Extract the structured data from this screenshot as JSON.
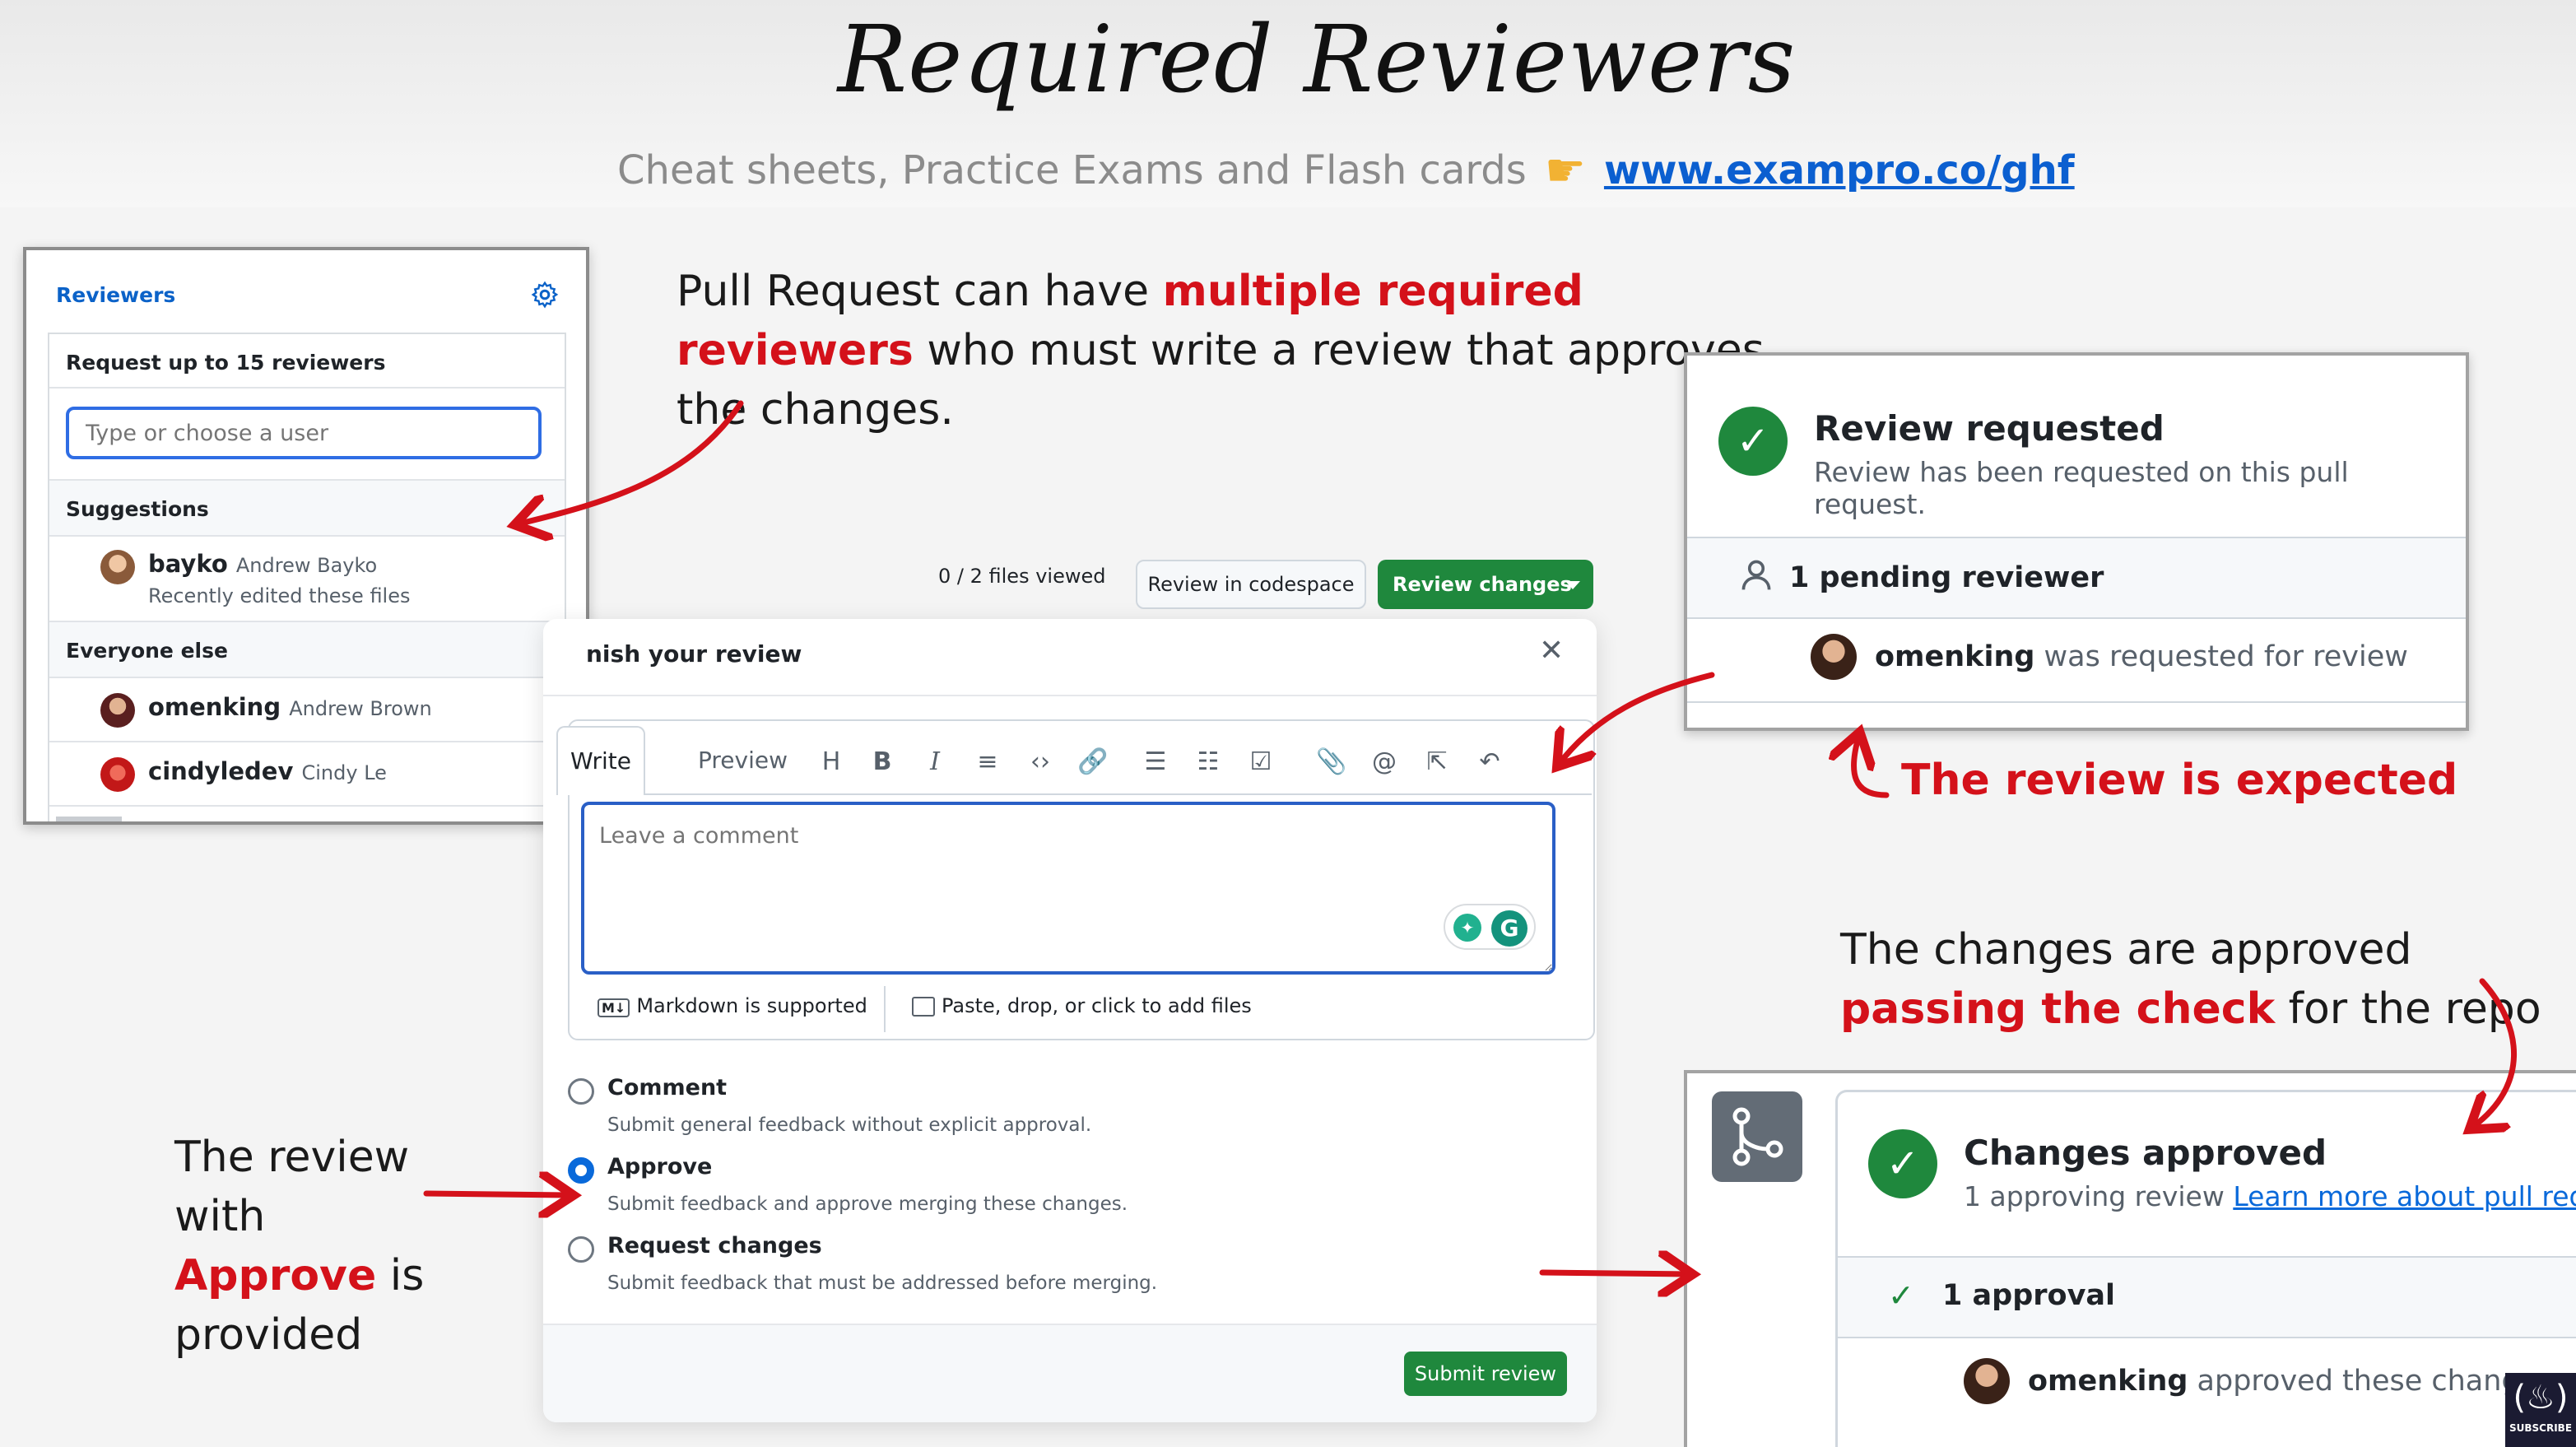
{
  "slide": {
    "title": "Required Reviewers",
    "subtitle": "Cheat sheets, Practice Exams and Flash cards",
    "subtitle_icon": "pointing-hand-icon",
    "link": "www.exampro.co/ghf"
  },
  "notes": {
    "top_a": "Pull Request can have ",
    "top_b": "multiple required reviewers",
    "top_c": " who must write a review that approves the changes.",
    "expected": "The review is expected",
    "approved_a": "The changes are approved ",
    "approved_b": "passing the check",
    "approved_c": " for the repo",
    "given_a": "The review with ",
    "given_b": "Approve",
    "given_c": " is provided"
  },
  "reviewers": {
    "title": "Reviewers",
    "limit": "Request up to 15 reviewers",
    "placeholder": "Type or choose a user",
    "suggestions_heading": "Suggestions",
    "everyone_heading": "Everyone else",
    "suggestions": [
      {
        "login": "bayko",
        "name": "Andrew Bayko",
        "note": "Recently edited these files"
      }
    ],
    "everyone": [
      {
        "login": "omenking",
        "name": "Andrew Brown"
      },
      {
        "login": "cindyledev",
        "name": "Cindy Le"
      }
    ]
  },
  "review_form": {
    "files_viewed": "0 / 2 files viewed",
    "codespace_button": "Review in codespace",
    "review_button": "Review changes",
    "heading": "nish your review",
    "tabs": [
      "Write",
      "Preview"
    ],
    "toolbar_icons": [
      "heading-icon",
      "bold-icon",
      "italic-icon",
      "quote-icon",
      "code-icon",
      "link-icon",
      "numbered-list-icon",
      "bullet-list-icon",
      "task-list-icon",
      "attach-icon",
      "mention-icon",
      "reference-icon",
      "undo-icon"
    ],
    "comment_placeholder": "Leave a comment",
    "markdown_note": "Markdown is supported",
    "files_note": "Paste, drop, or click to add files",
    "options": [
      {
        "label": "Comment",
        "desc": "Submit general feedback without explicit approval.",
        "selected": false
      },
      {
        "label": "Approve",
        "desc": "Submit feedback and approve merging these changes.",
        "selected": true
      },
      {
        "label": "Request changes",
        "desc": "Submit feedback that must be addressed before merging.",
        "selected": false
      }
    ],
    "submit_button": "Submit review"
  },
  "requested": {
    "title": "Review requested",
    "subtitle": "Review has been requested on this pull request.",
    "pending": "1 pending reviewer",
    "user": "omenking",
    "user_text": " was requested for review"
  },
  "approved": {
    "title": "Changes approved",
    "subtitle": "1 approving review ",
    "link": "Learn more about pull requ",
    "count": "1 approval",
    "user": "omenking",
    "user_text": " approved these changes"
  },
  "badge": {
    "label": "SUBSCRIBE"
  },
  "colors": {
    "accent_red": "#d4111a",
    "github_green": "#1f883d",
    "link_blue": "#0969da"
  }
}
